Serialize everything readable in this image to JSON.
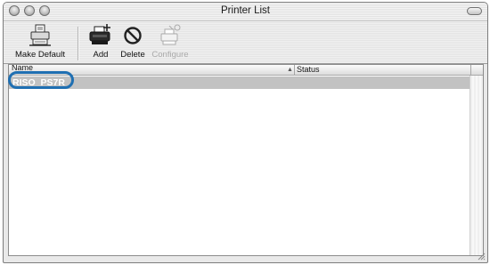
{
  "window": {
    "title": "Printer List",
    "icons": {
      "close": "close-light-icon",
      "minimize": "minimize-light-icon",
      "zoom": "zoom-light-icon",
      "toolbar_toggle": "toolbar-toggle-icon"
    }
  },
  "toolbar": {
    "make_default": {
      "label": "Make Default",
      "icon": "printer-default-icon"
    },
    "add": {
      "label": "Add",
      "icon": "printer-add-icon"
    },
    "delete": {
      "label": "Delete",
      "icon": "delete-circle-icon"
    },
    "configure": {
      "label": "Configure",
      "icon": "printer-configure-icon",
      "enabled": false
    }
  },
  "list": {
    "columns": {
      "name": "Name",
      "status": "Status"
    },
    "sort": {
      "column": "name",
      "direction": "ascending"
    },
    "rows": [
      {
        "name": "RISO_PS7R",
        "status": "",
        "selected": true
      }
    ],
    "highlight_color": "#1f6fb2",
    "selection_color": "#c2c2c2"
  }
}
